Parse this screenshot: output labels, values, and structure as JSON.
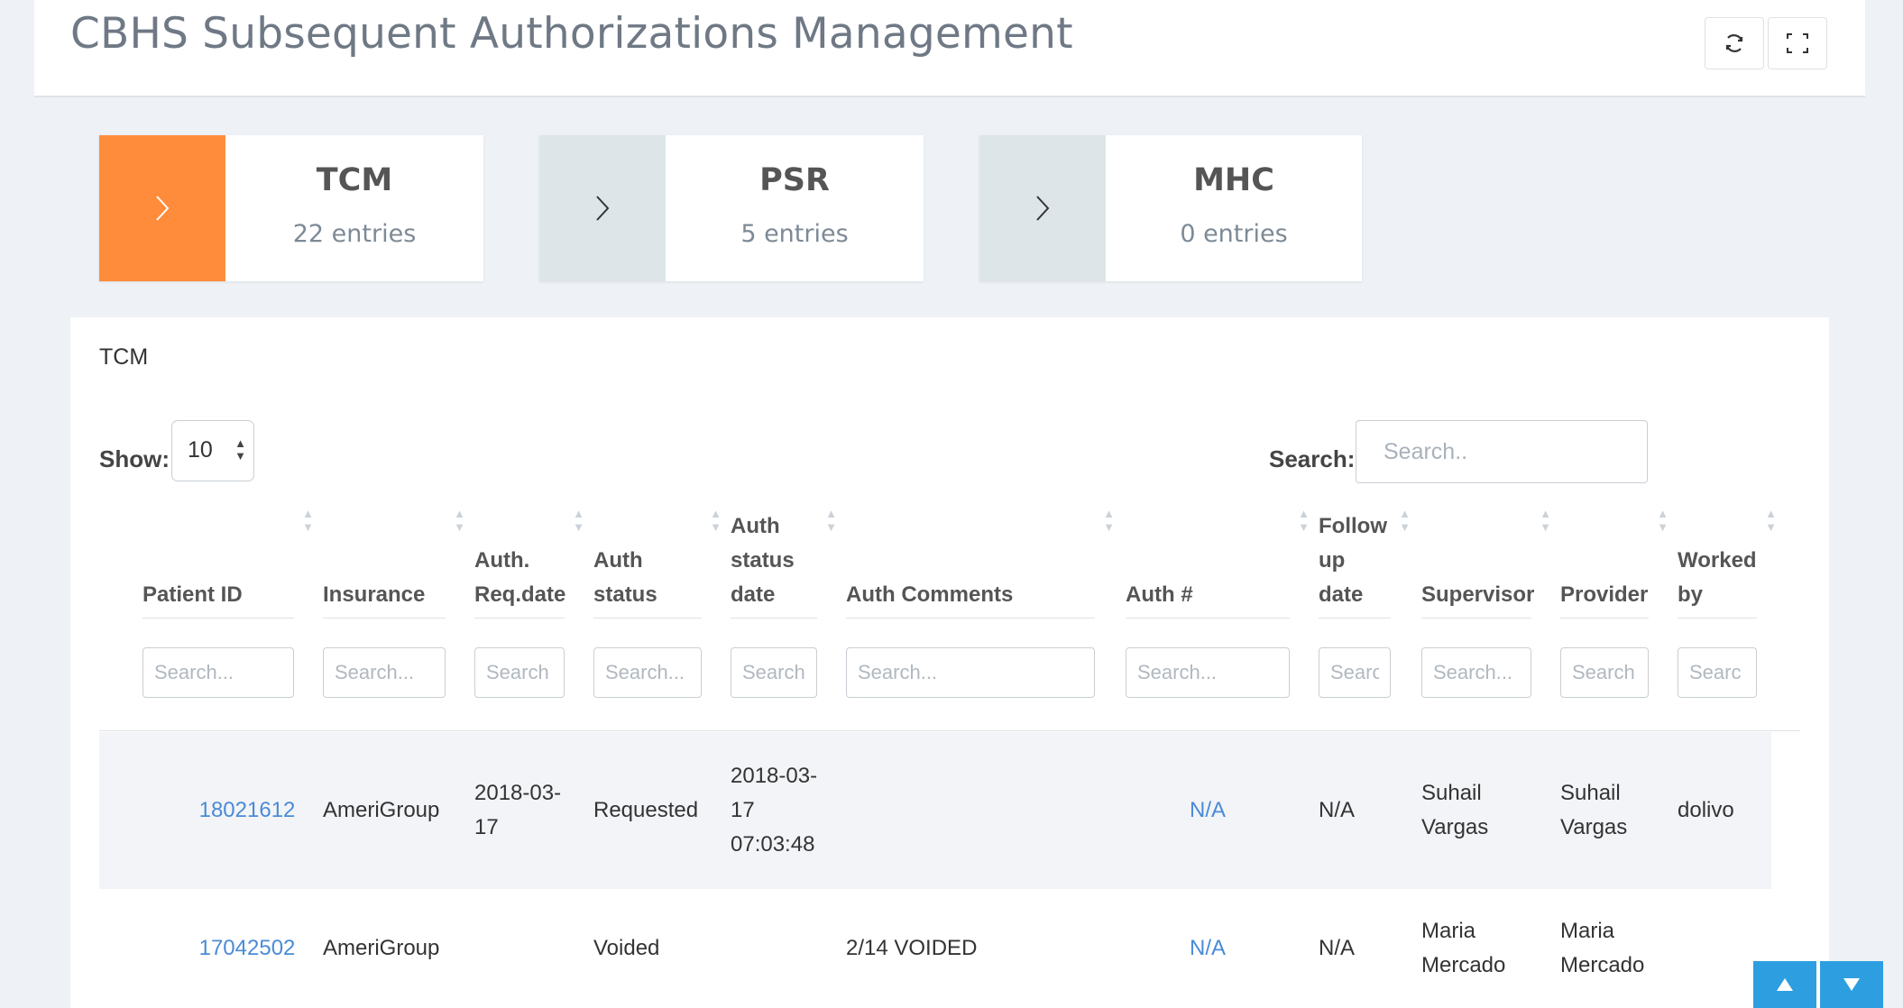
{
  "header": {
    "title": "CBHS Subsequent Authorizations Management"
  },
  "tiles": [
    {
      "title": "TCM",
      "count": "22 entries"
    },
    {
      "title": "PSR",
      "count": "5 entries"
    },
    {
      "title": "MHC",
      "count": "0 entries"
    }
  ],
  "panel": {
    "title": "TCM",
    "show_label": "Show:",
    "show_value": "10",
    "search_label": "Search:",
    "search_placeholder": "Search.."
  },
  "table": {
    "columns": [
      {
        "label": "Patient ID",
        "filter_placeholder": "Search..."
      },
      {
        "label": "Insurance",
        "filter_placeholder": "Search..."
      },
      {
        "label": "Auth. Req.date",
        "filter_placeholder": "Search"
      },
      {
        "label": "Auth status",
        "filter_placeholder": "Search..."
      },
      {
        "label": "Auth status date",
        "filter_placeholder": "Search"
      },
      {
        "label": "Auth Comments",
        "filter_placeholder": "Search..."
      },
      {
        "label": "Auth #",
        "filter_placeholder": "Search..."
      },
      {
        "label": "Follow up date",
        "filter_placeholder": "Searc"
      },
      {
        "label": "Supervisor",
        "filter_placeholder": "Search..."
      },
      {
        "label": "Provider",
        "filter_placeholder": "Search"
      },
      {
        "label": "Worked by",
        "filter_placeholder": "Searc"
      }
    ],
    "rows": [
      {
        "patient_id": "18021612",
        "insurance": "AmeriGroup",
        "auth_req_date": "2018-03-17",
        "auth_status": "Requested",
        "auth_status_date": "2018-03-17 07:03:48",
        "auth_comments": "",
        "auth_number": "N/A",
        "follow_up_date": "N/A",
        "supervisor": "Suhail Vargas",
        "provider": "Suhail Vargas",
        "worked_by": "dolivo"
      },
      {
        "patient_id": "17042502",
        "insurance": "AmeriGroup",
        "auth_req_date": "",
        "auth_status": "Voided",
        "auth_status_date": "",
        "auth_comments": "2/14 VOIDED",
        "auth_number": "N/A",
        "follow_up_date": "N/A",
        "supervisor": "Maria Mercado",
        "provider": "Maria Mercado",
        "worked_by": ""
      }
    ]
  },
  "colors": {
    "tile_active": "#ff8c3a",
    "tile_inactive": "#dde5e8",
    "link": "#4a8bd6",
    "scroll_button": "#2d9fe0"
  },
  "icons": {
    "refresh": "refresh-icon",
    "fullscreen": "fullscreen-icon",
    "tile_arrow": "chevron-right-icon",
    "scroll_up": "arrow-up-icon",
    "scroll_down": "arrow-down-icon"
  }
}
